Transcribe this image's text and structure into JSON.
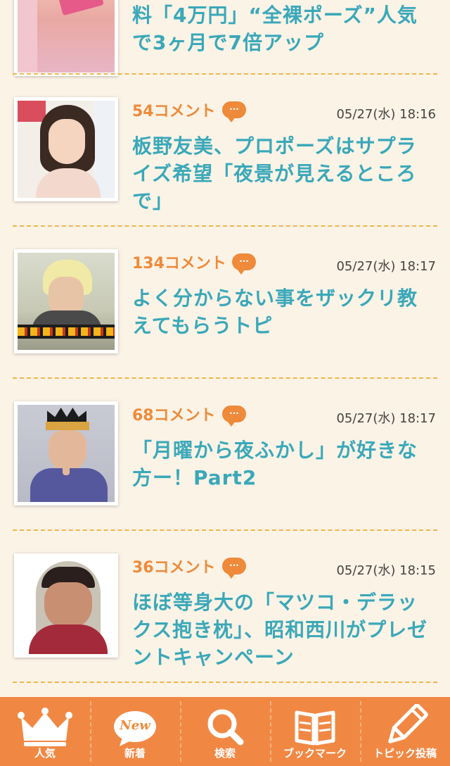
{
  "colors": {
    "accent": "#ee8a3a",
    "title": "#3aa8b9",
    "tabbar": "#f08844",
    "background": "#fbf3e6",
    "separator": "#f0b548"
  },
  "partial_item": {
    "title_line1": "料「4万円」“全裸ポーズ”人気",
    "title_line2": "で3ヶ月で7倍アップ"
  },
  "items": [
    {
      "comments": "54コメント",
      "date": "05/27(水) 18:16",
      "title": "板野友美、プロポーズはサプライズ希望「夜景が見えるところで」"
    },
    {
      "comments": "134コメント",
      "date": "05/27(水) 18:17",
      "title": "よく分からない事をザックリ教えてもらうトピ"
    },
    {
      "comments": "68コメント",
      "date": "05/27(水) 18:17",
      "title": "「月曜から夜ふかし」が好きな方ー！Part2"
    },
    {
      "comments": "36コメント",
      "date": "05/27(水) 18:15",
      "title": "ほぼ等身大の「マツコ・デラックス抱き枕」、昭和西川がプレゼントキャンペーン"
    }
  ],
  "tabs": [
    {
      "label": "人気",
      "icon": "crown-icon"
    },
    {
      "label": "新着",
      "icon": "new-badge-icon",
      "badge": "New"
    },
    {
      "label": "検索",
      "icon": "search-icon"
    },
    {
      "label": "ブックマーク",
      "icon": "book-icon"
    },
    {
      "label": "トピック投稿",
      "icon": "pencil-icon"
    }
  ],
  "comment_bubble_text": "···"
}
